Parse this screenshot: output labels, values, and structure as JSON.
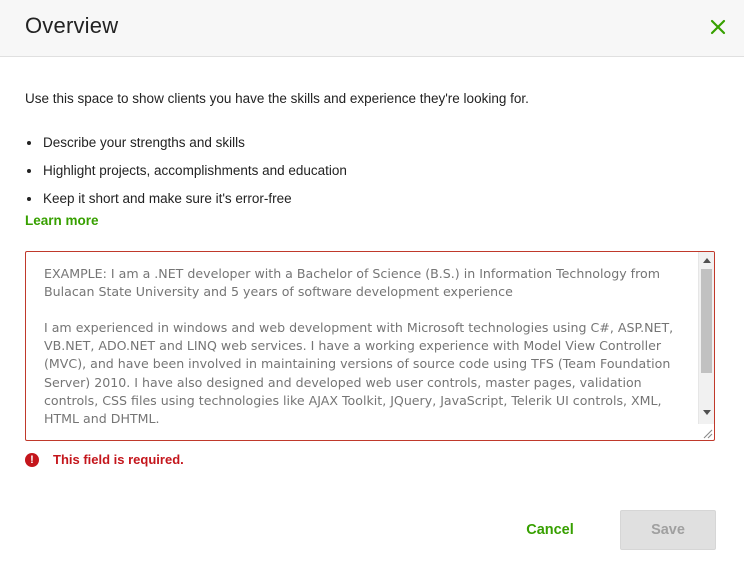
{
  "dialog": {
    "title": "Overview",
    "close_icon": "close-icon",
    "accent_color": "#37a000",
    "error_color": "#c4161c"
  },
  "content": {
    "intro": "Use this space to show clients you have the skills and experience they're looking for.",
    "bullets": [
      "Describe your strengths and skills",
      "Highlight projects, accomplishments and education",
      "Keep it short and make sure it's error-free"
    ],
    "learn_more": "Learn more"
  },
  "overview_field": {
    "placeholder": "EXAMPLE: I am a .NET developer with a Bachelor of Science (B.S.) in Information Technology from Bulacan State University and 5 years of software development experience\n\nI am experienced in windows and web development with Microsoft technologies using C#, ASP.NET, VB.NET, ADO.NET and LINQ web services. I have a working experience with Model View Controller (MVC), and have been involved in maintaining versions of source code using TFS (Team Foundation Server) 2010. I have also designed and developed web user controls, master pages, validation controls, CSS files using technologies like AJAX Toolkit, JQuery, JavaScript, Telerik UI controls, XML, HTML and DHTML.",
    "value": "",
    "error": "This field is required.",
    "error_icon": "alert-circle-icon"
  },
  "actions": {
    "cancel": "Cancel",
    "save": "Save"
  }
}
